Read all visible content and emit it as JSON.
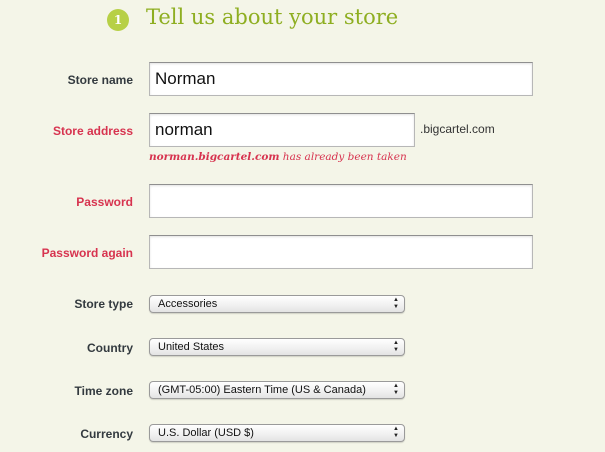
{
  "header": {
    "step_number": "1",
    "title": "Tell us about your store"
  },
  "form": {
    "store_name": {
      "label": "Store name",
      "value": "Norman"
    },
    "store_address": {
      "label": "Store address",
      "value": "norman",
      "suffix": ".bigcartel.com",
      "error_domain": "norman.bigcartel.com",
      "error_text": " has already been taken"
    },
    "password": {
      "label": "Password",
      "value": ""
    },
    "password_again": {
      "label": "Password again",
      "value": ""
    },
    "store_type": {
      "label": "Store type",
      "selected": "Accessories"
    },
    "country": {
      "label": "Country",
      "selected": "United States"
    },
    "time_zone": {
      "label": "Time zone",
      "selected": "(GMT-05:00) Eastern Time (US & Canada)"
    },
    "currency": {
      "label": "Currency",
      "selected": "U.S. Dollar (USD $)"
    }
  },
  "colors": {
    "background": "#f4f5e8",
    "accent_green": "#8eae21",
    "badge_green": "#b7d046",
    "error_red": "#d7334f",
    "label_dark": "#333a3f"
  },
  "icons": {
    "select_arrows": "up-down-chevron-icon"
  }
}
